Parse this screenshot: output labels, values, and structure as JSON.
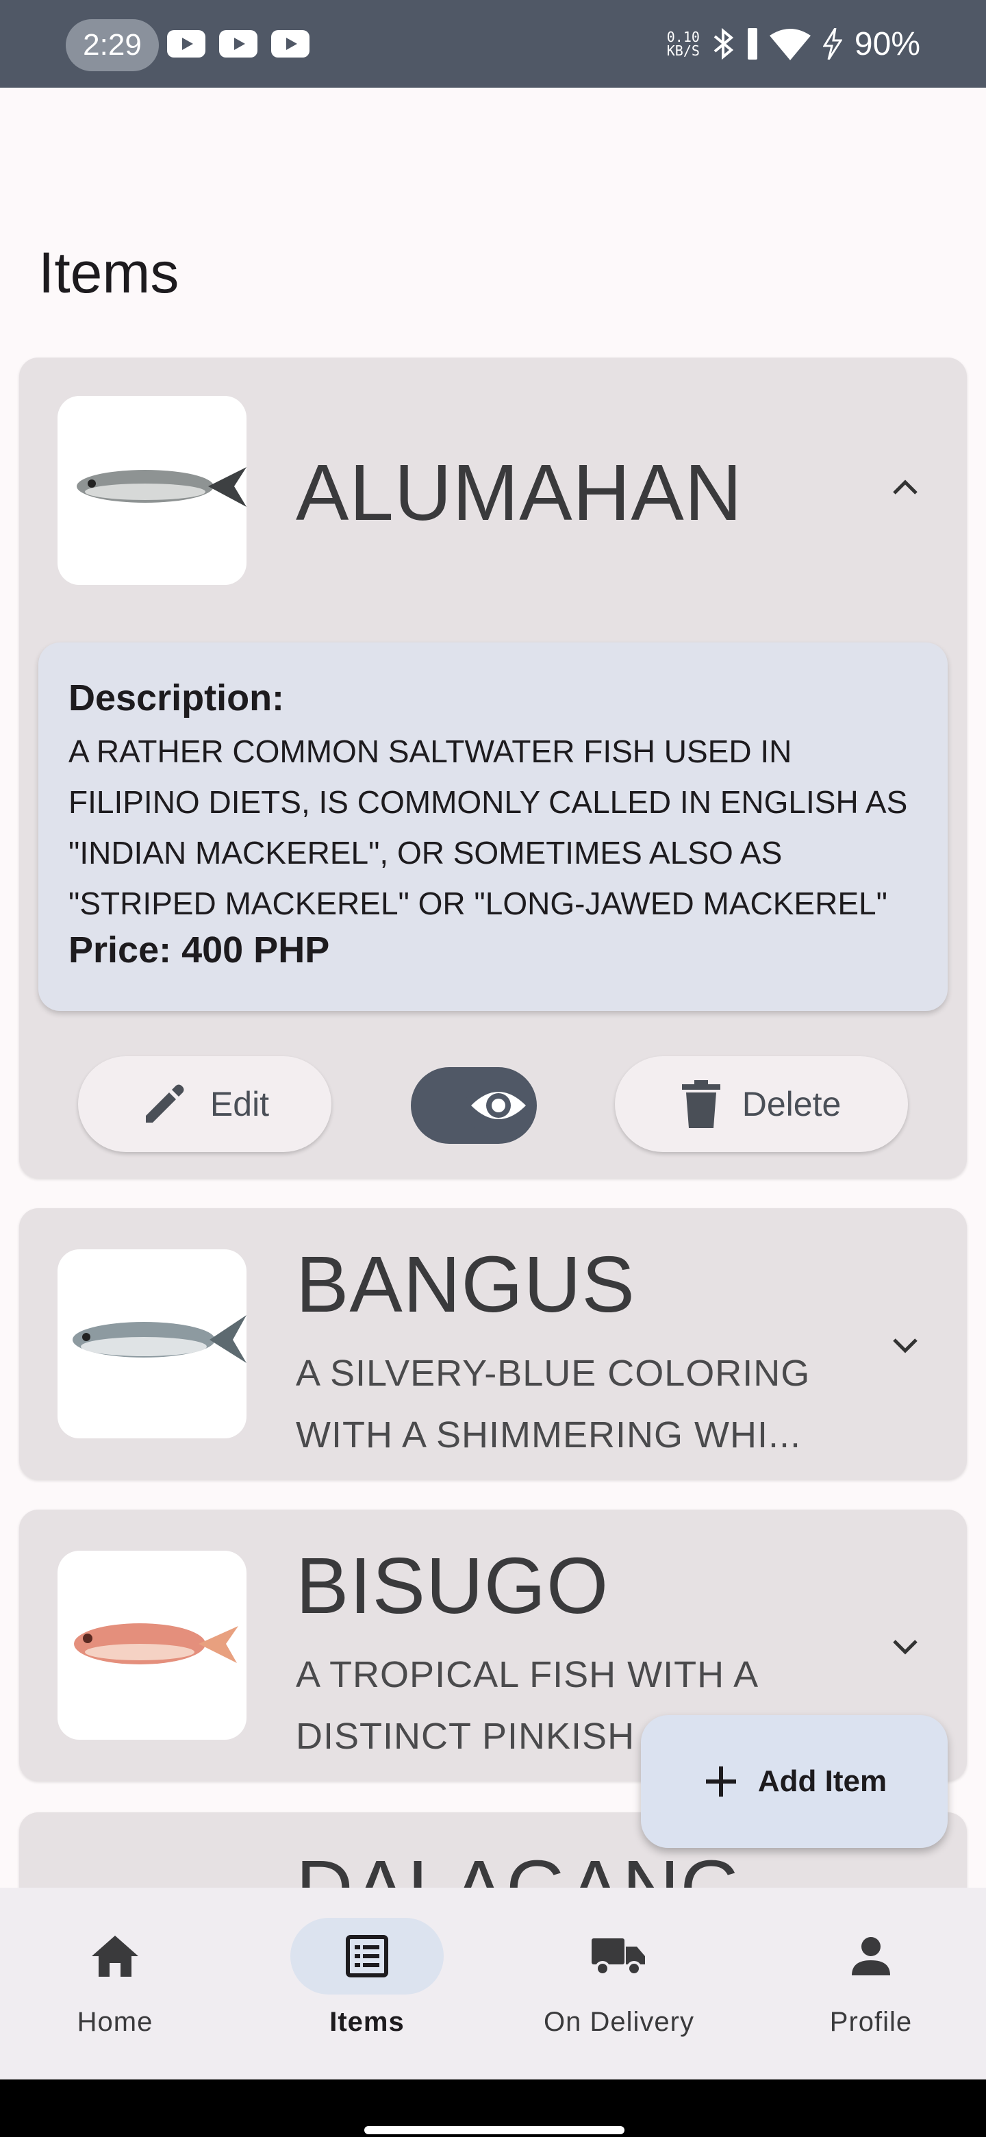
{
  "status_bar": {
    "time": "2:29",
    "net_speed_top": "0.10",
    "net_speed_bottom": "KB/S",
    "battery": "90%"
  },
  "page": {
    "title": "Items"
  },
  "items": [
    {
      "name": "ALUMAHAN",
      "expanded": true,
      "description_label": "Description:",
      "description": "A RATHER COMMON SALTWATER FISH USED IN FILIPINO DIETS, IS COMMONLY CALLED IN ENGLISH AS \"INDIAN MACKEREL\", OR SOMETIMES ALSO AS \"STRIPED MACKEREL\" OR \"LONG-JAWED MACKEREL\"",
      "price": "Price: 400 PHP",
      "fish_color": "#8e9393"
    },
    {
      "name": "BANGUS",
      "expanded": false,
      "snippet": "A SILVERY-BLUE COLORING WITH A SHIMMERING WHI...",
      "fish_color": "#8d9aa0"
    },
    {
      "name": "BISUGO",
      "expanded": false,
      "snippet": "A TROPICAL FISH WITH A DISTINCT PINKISH",
      "fish_color": "#e48f7c"
    },
    {
      "name": "DALAGANG",
      "expanded": false
    }
  ],
  "actions": {
    "edit_label": "Edit",
    "delete_label": "Delete"
  },
  "fab": {
    "label": "Add Item"
  },
  "bottom_nav": [
    {
      "label": "Home",
      "icon": "home-icon"
    },
    {
      "label": "Items",
      "icon": "list-icon",
      "active": true
    },
    {
      "label": "On Delivery",
      "icon": "truck-icon"
    },
    {
      "label": "Profile",
      "icon": "person-icon"
    }
  ],
  "colors": {
    "status_bar": "#505866",
    "card_bg": "#e6e1e3",
    "desc_bg": "#dfe2ec",
    "fab_bg": "#dbe2f0",
    "nav_active": "#dce3ef"
  }
}
